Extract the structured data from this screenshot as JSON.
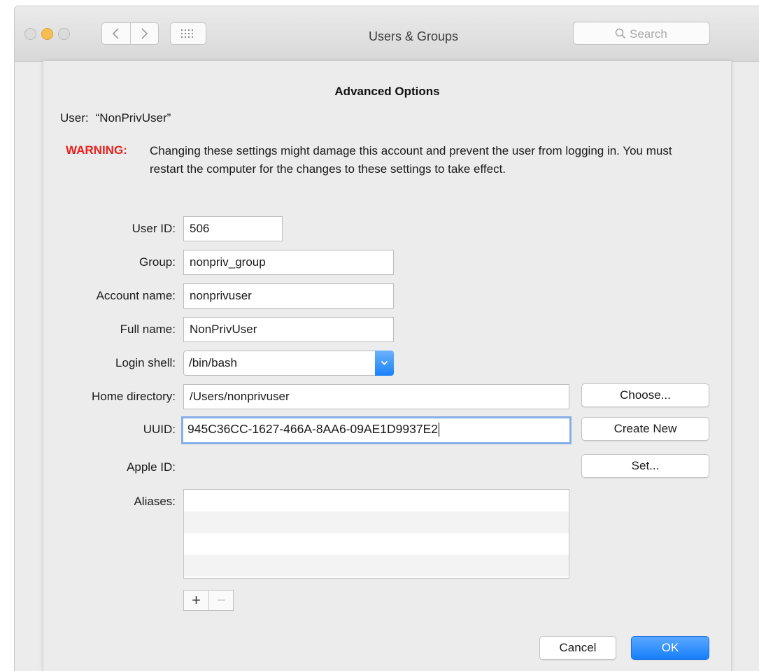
{
  "window": {
    "title": "Users & Groups",
    "search_placeholder": "Search"
  },
  "sheet": {
    "title": "Advanced Options",
    "user_label": "User:",
    "user_value": "“NonPrivUser”",
    "warning_label": "WARNING:",
    "warning_text": "Changing these settings might damage this account and prevent the user from logging in. You must restart the computer for the changes to these settings to take effect."
  },
  "form": {
    "user_id": {
      "label": "User ID:",
      "value": "506"
    },
    "group": {
      "label": "Group:",
      "value": "nonpriv_group"
    },
    "account_name": {
      "label": "Account name:",
      "value": "nonprivuser"
    },
    "full_name": {
      "label": "Full name:",
      "value": "NonPrivUser"
    },
    "login_shell": {
      "label": "Login shell:",
      "value": "/bin/bash"
    },
    "home_directory": {
      "label": "Home directory:",
      "value": "/Users/nonprivuser"
    },
    "uuid": {
      "label": "UUID:",
      "value": "945C36CC-1627-466A-8AA6-09AE1D9937E2"
    },
    "apple_id": {
      "label": "Apple ID:"
    },
    "aliases": {
      "label": "Aliases:",
      "items": []
    }
  },
  "buttons": {
    "choose": "Choose...",
    "create_new": "Create New",
    "set": "Set...",
    "add": "+",
    "remove": "−",
    "cancel": "Cancel",
    "ok": "OK"
  },
  "colors": {
    "warning": "#e8201c",
    "accent": "#177ffb",
    "focus_ring": "#84aee6"
  },
  "icons": {
    "back": "chevron-left-icon",
    "forward": "chevron-right-icon",
    "show_all": "grid-icon",
    "search": "magnifier-icon",
    "popup": "chevron-down-icon"
  }
}
